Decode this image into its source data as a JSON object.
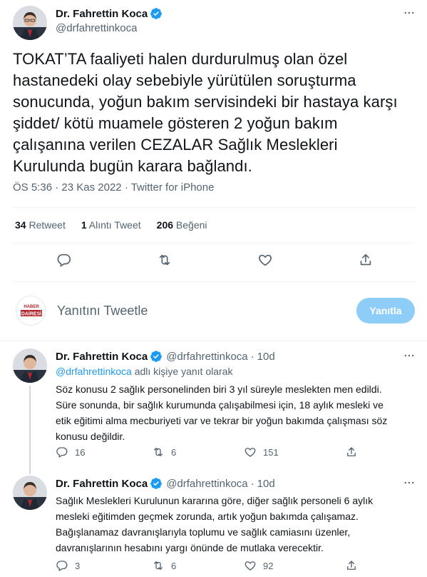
{
  "main_tweet": {
    "display_name": "Dr. Fahrettin Koca",
    "handle": "@drfahrettinkoca",
    "lines": [
      "TOKAT’TA faaliyeti halen durdurulmuş olan özel",
      "hastanedeki olay sebebiyle yürütülen soruşturma",
      "sonucunda, yoğun bakım servisindeki bir hastaya karşı",
      "şiddet/ kötü muamele gösteren 2 yoğun bakım",
      "çalışanına verilen CEZALAR Sağlık Meslekleri",
      "Kurulunda bugün karara bağlandı."
    ],
    "time": "ÖS 5:36",
    "date": "23 Kas 2022",
    "source": "Twitter for iPhone",
    "separator": "·",
    "stats": {
      "retweets_count": "34",
      "retweets_label": "Retweet",
      "quotes_count": "1",
      "quotes_label": "Alıntı Tweet",
      "likes_count": "206",
      "likes_label": "Beğeni"
    }
  },
  "reply_composer": {
    "avatar_text_top": "HABER",
    "avatar_text_bottom": "DAİRESİ",
    "placeholder": "Yanıtını Tweetle",
    "button_label": "Yanıtla"
  },
  "replies": [
    {
      "display_name": "Dr. Fahrettin Koca",
      "handle": "@drfahrettinkoca",
      "age": "10d",
      "separator": "·",
      "replying_mention": "@drfahrettinkoca",
      "replying_suffix": " adlı kişiye yanıt olarak",
      "lines": [
        "Söz konusu 2 sağlık personelinden biri 3 yıl süreyle meslekten men edildi.",
        "Süre sonunda, bir sağlık kurumunda çalışabilmesi için, 18 aylık mesleki ve",
        "etik eğitimi alma mecburiyeti var ve tekrar bir yoğun bakımda çalışması söz",
        "konusu değildir."
      ],
      "reply_count": "16",
      "retweet_count": "6",
      "like_count": "151"
    },
    {
      "display_name": "Dr. Fahrettin Koca",
      "handle": "@drfahrettinkoca",
      "age": "10d",
      "separator": "·",
      "lines": [
        "Sağlık Meslekleri Kurulunun kararına göre, diğer sağlık personeli 6 aylık",
        "mesleki eğitimden geçmek zorunda, artık yoğun bakımda çalışamaz.",
        "Bağışlanamaz davranışlarıyla toplumu ve sağlık camiasını üzenler,",
        "davranışlarının hesabını yargı önünde de mutlaka verecektir."
      ],
      "reply_count": "3",
      "retweet_count": "6",
      "like_count": "92"
    }
  ],
  "colors": {
    "accent": "#1d9bf0",
    "text": "#0f1419",
    "secondary": "#536471",
    "divider": "#eff3f4",
    "reply_button": "#8ecdf8"
  },
  "icons": [
    "verified-badge-icon",
    "more-icon",
    "reply-icon",
    "retweet-icon",
    "like-icon",
    "share-icon"
  ]
}
